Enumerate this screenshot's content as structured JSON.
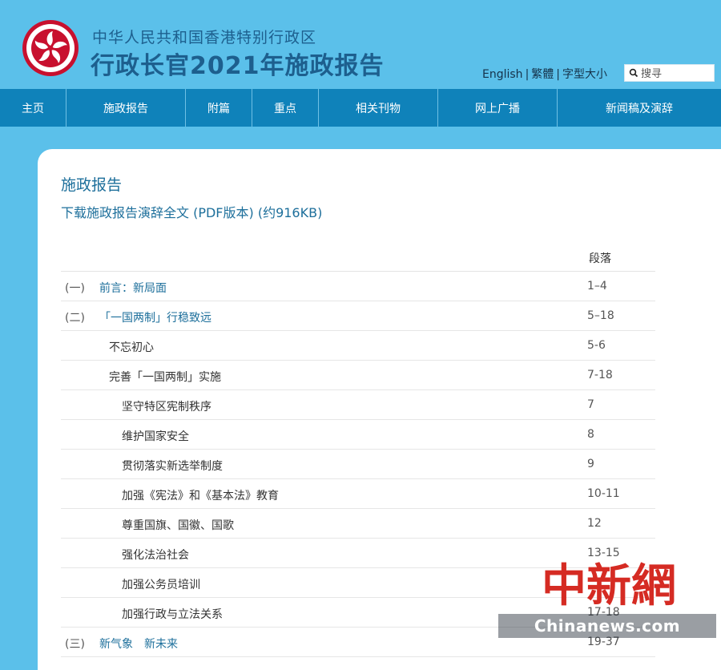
{
  "header": {
    "region": "中华人民共和国香港特别行政区",
    "title": "行政长官2021年施政报告",
    "lang": {
      "english": "English",
      "traditional": "繁體",
      "sep": "|",
      "font_size": "字型大小"
    },
    "search": {
      "placeholder": "搜寻"
    }
  },
  "nav": {
    "items": [
      "主页",
      "施政报告",
      "附篇",
      "重点",
      "相关刊物",
      "网上广播",
      "新闻稿及演辞"
    ]
  },
  "main": {
    "title": "施政报告",
    "download": "下载施政报告演辞全文 (PDF版本) (约916KB)",
    "column_header": "段落",
    "rows": [
      {
        "num": "(一)",
        "label": "前言：新局面",
        "para": "1–4"
      },
      {
        "num": "(二)",
        "label": "「一国两制」行稳致远",
        "para": "5–18"
      },
      {
        "num": "",
        "label": "不忘初心",
        "para": "5-6"
      },
      {
        "num": "",
        "label": "完善「一国两制」实施",
        "para": "7-18"
      },
      {
        "num": "",
        "label": "坚守特区宪制秩序",
        "para": "7"
      },
      {
        "num": "",
        "label": "维护国家安全",
        "para": "8"
      },
      {
        "num": "",
        "label": "贯彻落实新选举制度",
        "para": "9"
      },
      {
        "num": "",
        "label": "加强《宪法》和《基本法》教育",
        "para": "10-11"
      },
      {
        "num": "",
        "label": "尊重国旗、国徽、国歌",
        "para": "12"
      },
      {
        "num": "",
        "label": "强化法治社会",
        "para": "13-15"
      },
      {
        "num": "",
        "label": "加强公务员培训",
        "para": ""
      },
      {
        "num": "",
        "label": "加强行政与立法关系",
        "para": "17-18"
      },
      {
        "num": "(三)",
        "label": "新气象　新未来",
        "para": "19-37"
      }
    ]
  },
  "watermark": {
    "chars": "中新網",
    "site": "Chinanews.com"
  },
  "colors": {
    "background": "#5bc0ea",
    "nav": "#0f82ba",
    "link": "#1d6f9b",
    "title": "#1d5f8e"
  }
}
